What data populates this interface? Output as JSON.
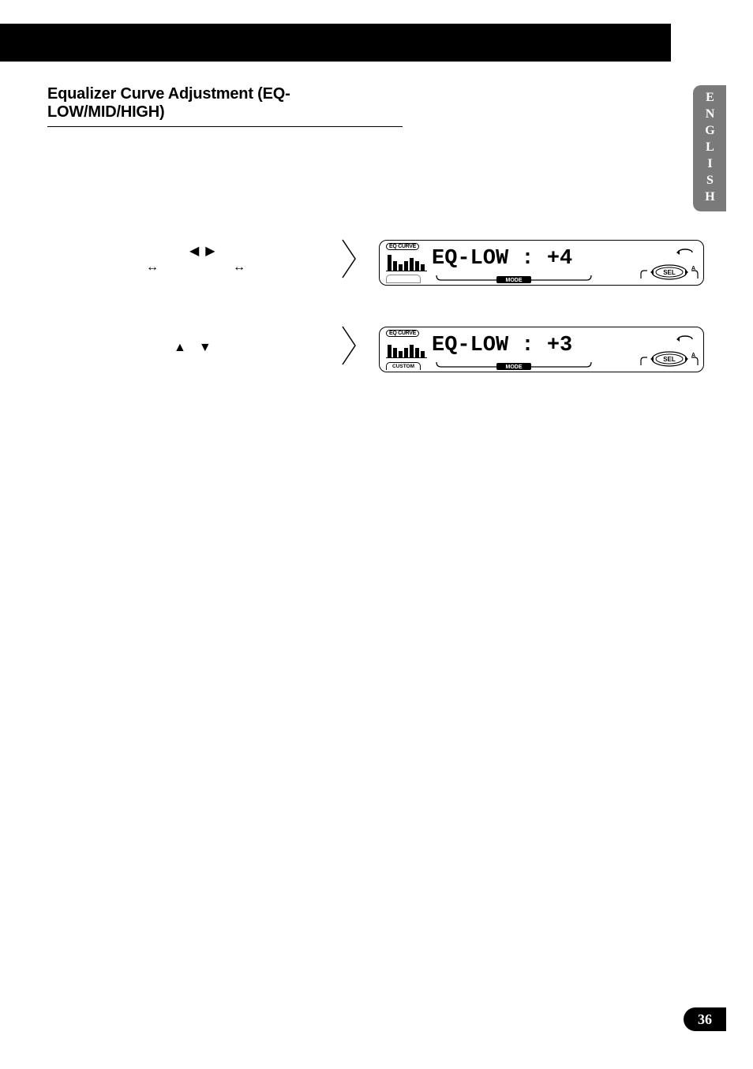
{
  "header": {
    "section_title": "Equalizer Curve Adjustment (EQ-LOW/MID/HIGH)"
  },
  "language_tab": "ENGLISH",
  "page_number": "36",
  "step1": {
    "left_right_arrows": "◀ ▶",
    "dbl_arrow_left": "↔",
    "dbl_arrow_right": "↔",
    "lcd": {
      "eqcurve_label": "EQ CURVE",
      "bottom_left_label": "",
      "main_text": "EQ-LOW : +4",
      "mode_label": "MODE",
      "sel_label": "SEL",
      "a_label": "A"
    }
  },
  "step2": {
    "up_down_arrows": "▲ ▼",
    "lcd": {
      "eqcurve_label": "EQ CURVE",
      "bottom_left_label": "CUSTOM",
      "main_text": "EQ-LOW : +3",
      "mode_label": "MODE",
      "sel_label": "SEL",
      "a_label": "A"
    }
  }
}
